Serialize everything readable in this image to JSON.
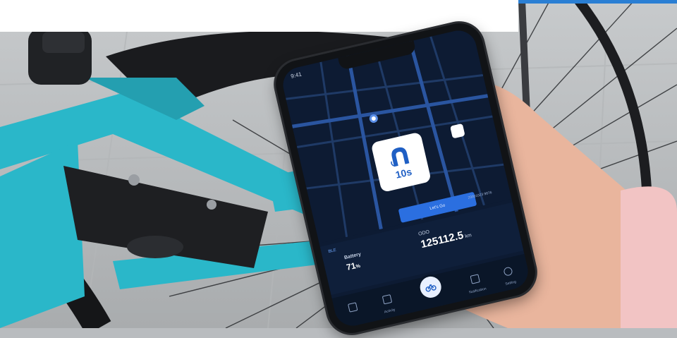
{
  "colors": {
    "frame": "#2ab7c9",
    "map_bg": "#0d1b33",
    "accent": "#2b6fe0",
    "top_bar": "#2a7fd4"
  },
  "phone": {
    "status_time": "9:41",
    "lock_card": {
      "label": "10s",
      "icon": "bike-lock-icon"
    },
    "go_button": "Let's Go",
    "device_id": "20001023 9876",
    "connection": "BLE",
    "battery": {
      "title": "Battery",
      "value": "71",
      "unit": "%"
    },
    "odo": {
      "title": "ODO",
      "value": "125112.5",
      "unit": "km"
    },
    "tabs": [
      {
        "label": "",
        "icon": "home-icon"
      },
      {
        "label": "Activity",
        "icon": "activity-icon"
      },
      {
        "label": "",
        "icon": "bike-icon"
      },
      {
        "label": "Notification",
        "icon": "bell-icon"
      },
      {
        "label": "Setting",
        "icon": "gear-icon"
      }
    ]
  }
}
